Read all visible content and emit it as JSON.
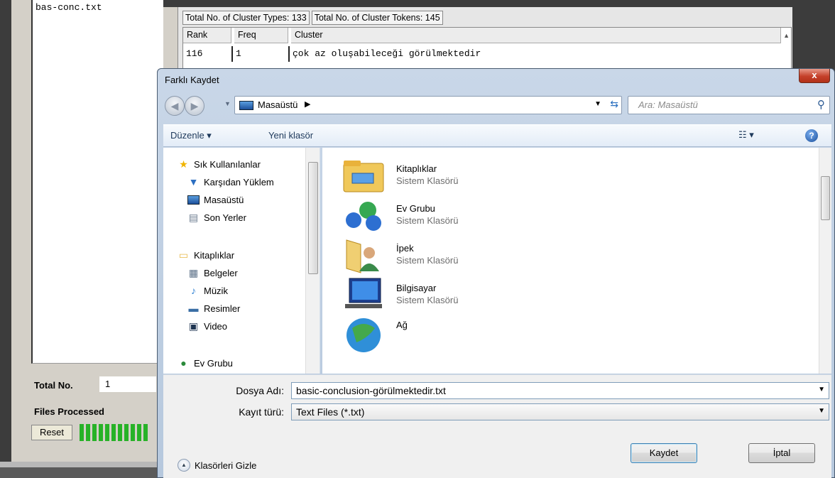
{
  "background_app": {
    "file_list": [
      "bas-conc.txt"
    ],
    "total_label": "Total No.",
    "total_value": "1",
    "files_processed_label": "Files Processed",
    "reset_label": "Reset",
    "cluster_types": "Total No. of Cluster Types: 133",
    "cluster_tokens": "Total No. of Cluster Tokens: 145",
    "columns": [
      "Rank",
      "Freq",
      "Cluster"
    ],
    "rows": [
      {
        "rank": "116",
        "freq": "1",
        "cluster": "çok az oluşabileceği görülmektedir"
      }
    ],
    "progress_color": "#27b227"
  },
  "dialog": {
    "title": "Farklı Kaydet",
    "close_label": "x",
    "address": {
      "location": "Masaüstü",
      "search_placeholder": "Ara: Masaüstü"
    },
    "toolbar": {
      "organize": "Düzenle ▾",
      "new_folder": "Yeni klasör"
    },
    "nav": {
      "favorites_header": "Sık Kullanılanlar",
      "favorites": [
        "Karşıdan Yüklem",
        "Masaüstü",
        "Son Yerler"
      ],
      "libraries_header": "Kitaplıklar",
      "libraries": [
        "Belgeler",
        "Müzik",
        "Resimler",
        "Video"
      ],
      "homegroup": "Ev Grubu"
    },
    "items": [
      {
        "name": "Kitaplıklar",
        "type": "Sistem Klasörü",
        "icon": "libraries-icon"
      },
      {
        "name": "Ev Grubu",
        "type": "Sistem Klasörü",
        "icon": "homegroup-icon"
      },
      {
        "name": "İpek",
        "type": "Sistem Klasörü",
        "icon": "user-folder-icon"
      },
      {
        "name": "Bilgisayar",
        "type": "Sistem Klasörü",
        "icon": "computer-icon"
      },
      {
        "name": "Ağ",
        "type": "",
        "icon": "network-icon"
      }
    ],
    "filename_label": "Dosya Adı:",
    "filename_value": "basic-conclusion-görülmektedir.txt",
    "filetype_label": "Kayıt türü:",
    "filetype_value": "Text Files (*.txt)",
    "hide_folders_label": "Klasörleri Gizle",
    "save_label": "Kaydet",
    "cancel_label": "İptal"
  }
}
